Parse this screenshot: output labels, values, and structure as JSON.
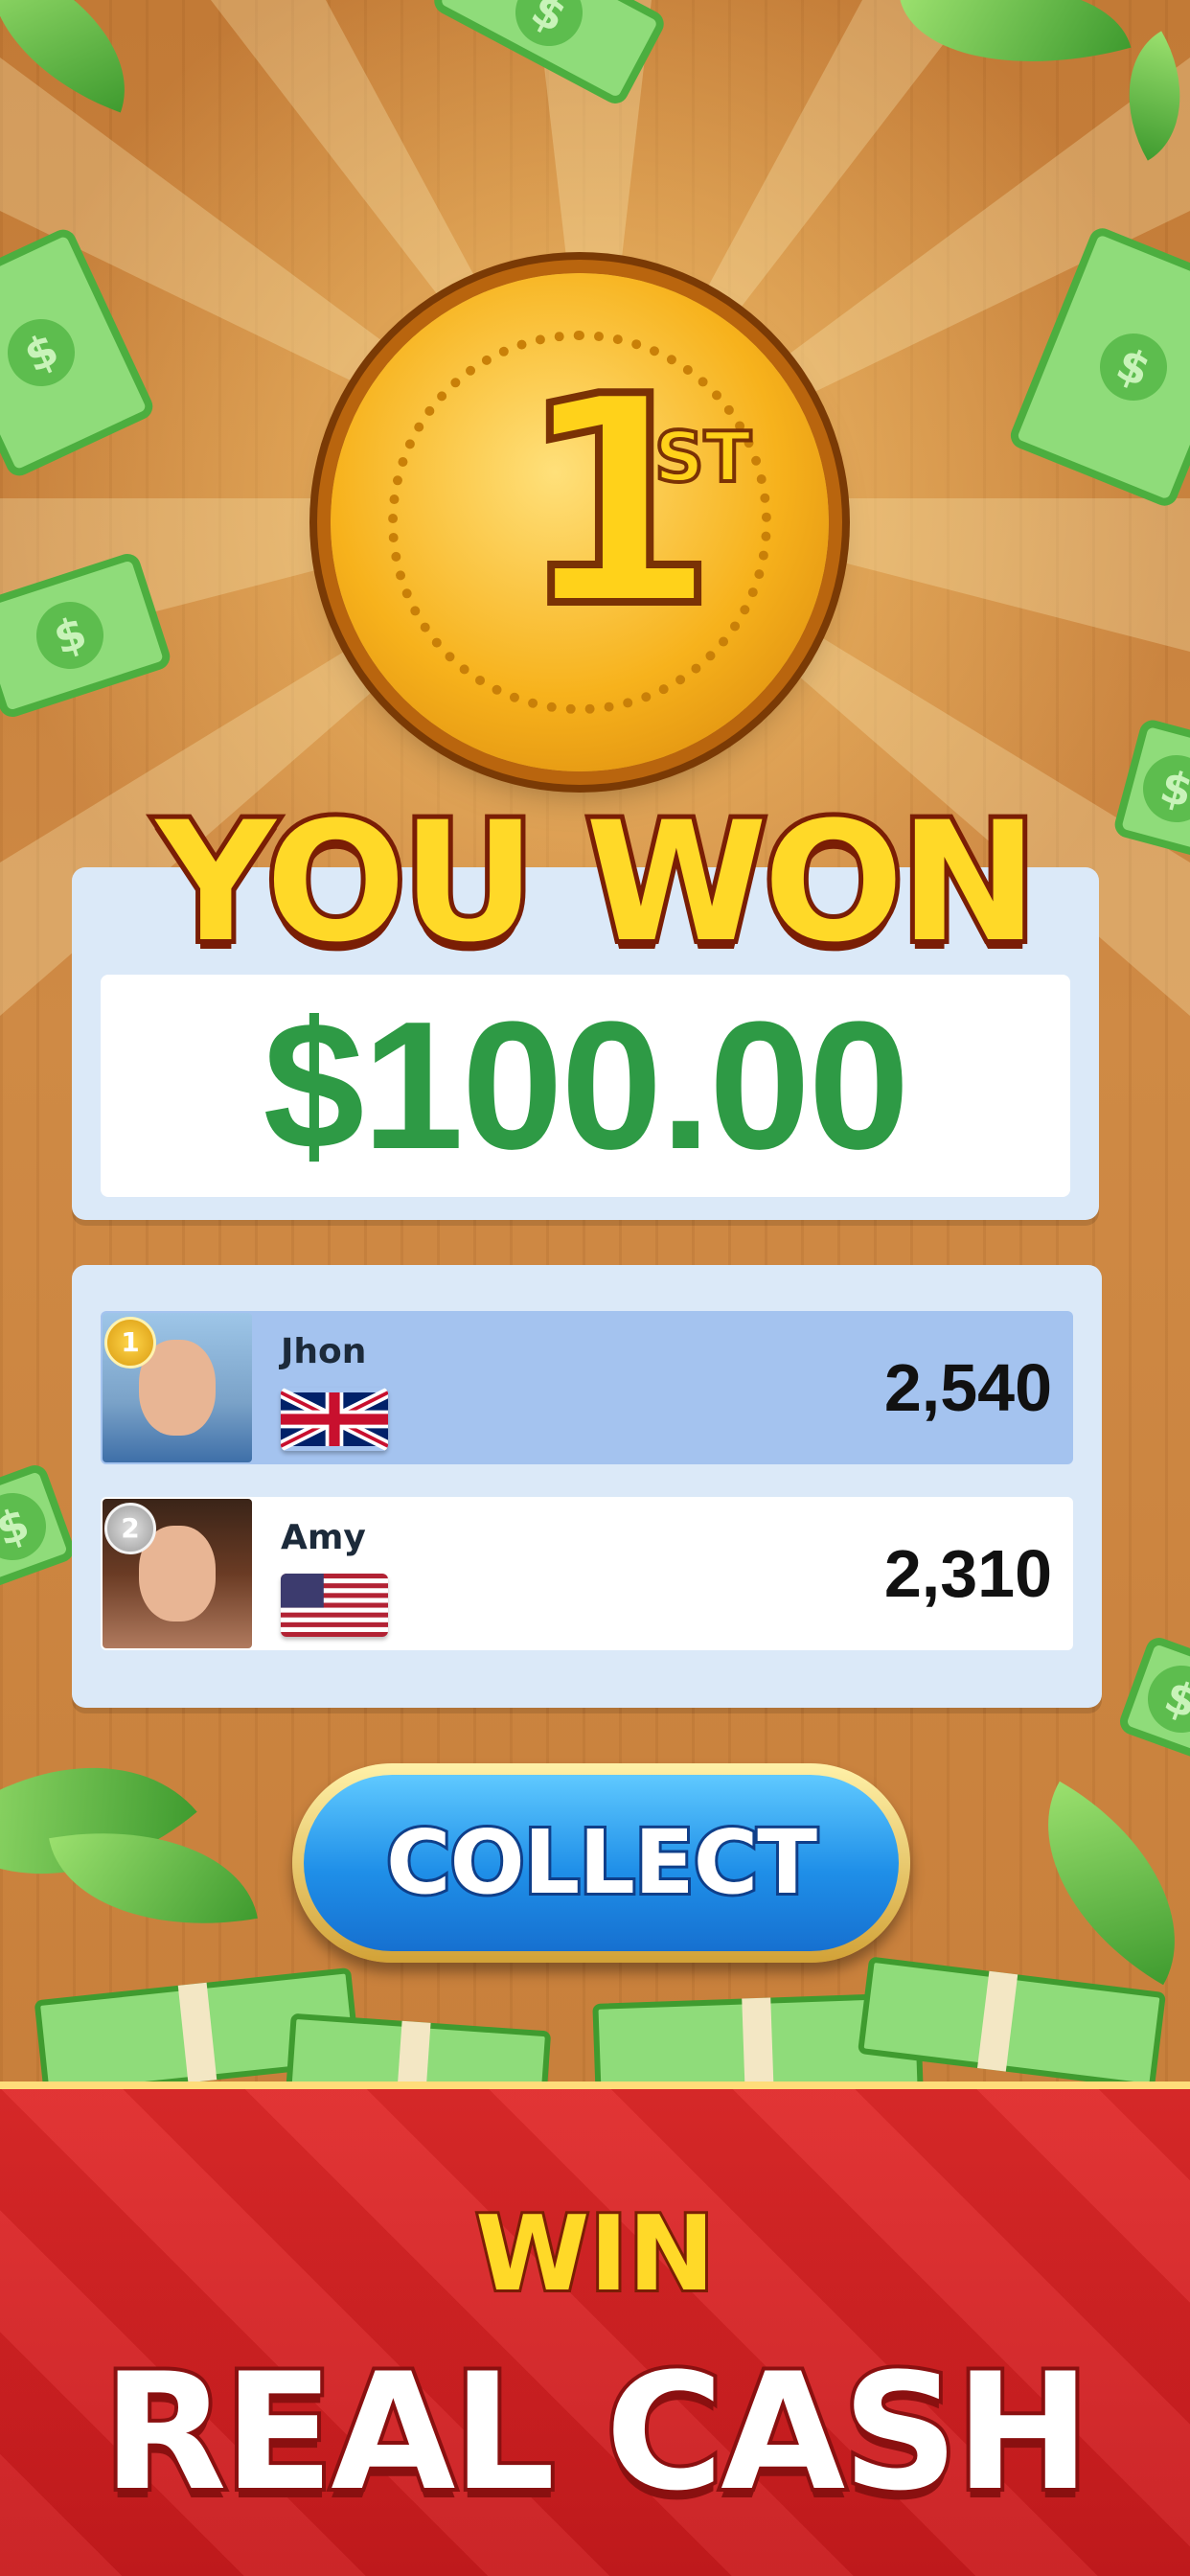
{
  "colors": {
    "prize_green": "#2e9a45",
    "title_yellow": "#ffd928",
    "button_blue": "#1f8fe8",
    "banner_red": "#d42022",
    "panel_blue": "#dbe9f8",
    "row_highlight": "#a4c3ef"
  },
  "coin": {
    "rank_number": "1",
    "rank_suffix": "ST"
  },
  "title": "YOU WON",
  "prize": {
    "amount": "$100.00"
  },
  "leaderboard": {
    "players": [
      {
        "rank": "1",
        "name": "Jhon",
        "flag": "uk-flag-icon",
        "score": "2,540"
      },
      {
        "rank": "2",
        "name": "Amy",
        "flag": "us-flag-icon",
        "score": "2,310"
      }
    ]
  },
  "collect_button": {
    "label": "COLLECT"
  },
  "banner": {
    "line1": "WIN",
    "line2": "REAL CASH"
  }
}
